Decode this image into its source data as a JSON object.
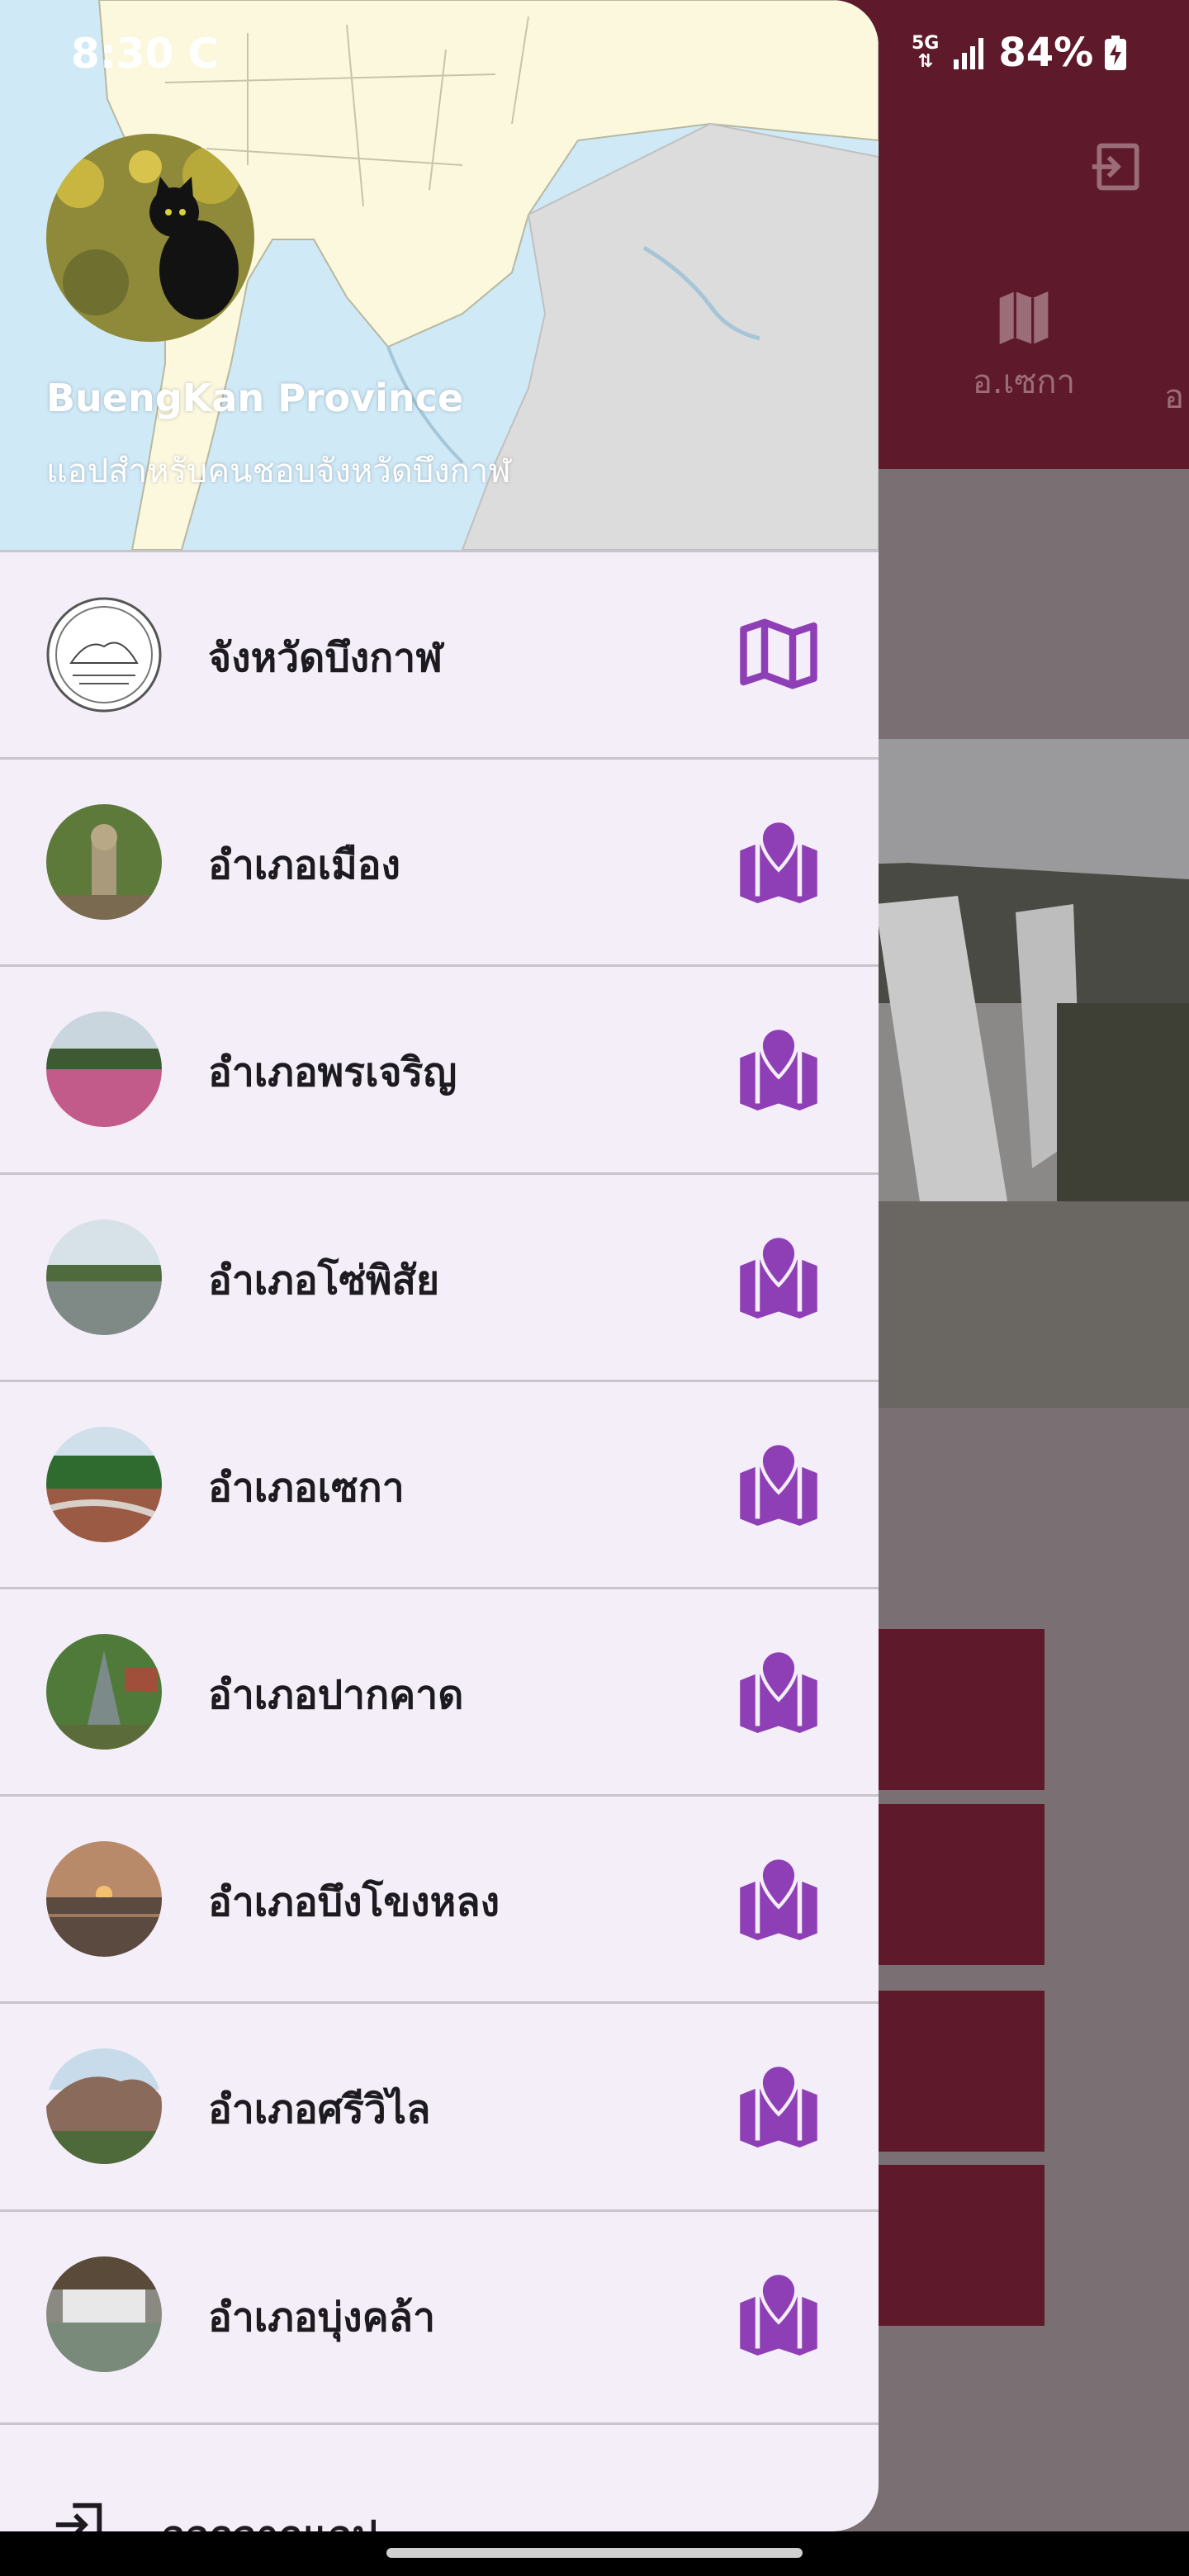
{
  "status_bar": {
    "time": "8:30 C",
    "network": "5G",
    "battery": "84%"
  },
  "background": {
    "tab_label": "อ.เซกา",
    "tab_next_label": "อ",
    "header_color": "#5e1a2b"
  },
  "drawer": {
    "app_name": "BuengKan Province",
    "app_subtitle": "แอปสำหรับคนชอบจังหวัดบึงกาฬ",
    "items": [
      {
        "label": "จังหวัดบึงกาฬ",
        "icon": "map-outline-icon"
      },
      {
        "label": "อำเภอเมือง",
        "icon": "map-pin-icon"
      },
      {
        "label": "อำเภอพรเจริญ",
        "icon": "map-pin-icon"
      },
      {
        "label": "อำเภอโซ่พิสัย",
        "icon": "map-pin-icon"
      },
      {
        "label": "อำเภอเซกา",
        "icon": "map-pin-icon"
      },
      {
        "label": "อำเภอปากคาด",
        "icon": "map-pin-icon"
      },
      {
        "label": "อำเภอบึงโขงหลง",
        "icon": "map-pin-icon"
      },
      {
        "label": "อำเภอศรีวิไล",
        "icon": "map-pin-icon"
      },
      {
        "label": "อำเภอบุ่งคล้า",
        "icon": "map-pin-icon"
      }
    ],
    "logout_label": "ออกจากแอป",
    "accent_color": "#8e3fb5"
  }
}
